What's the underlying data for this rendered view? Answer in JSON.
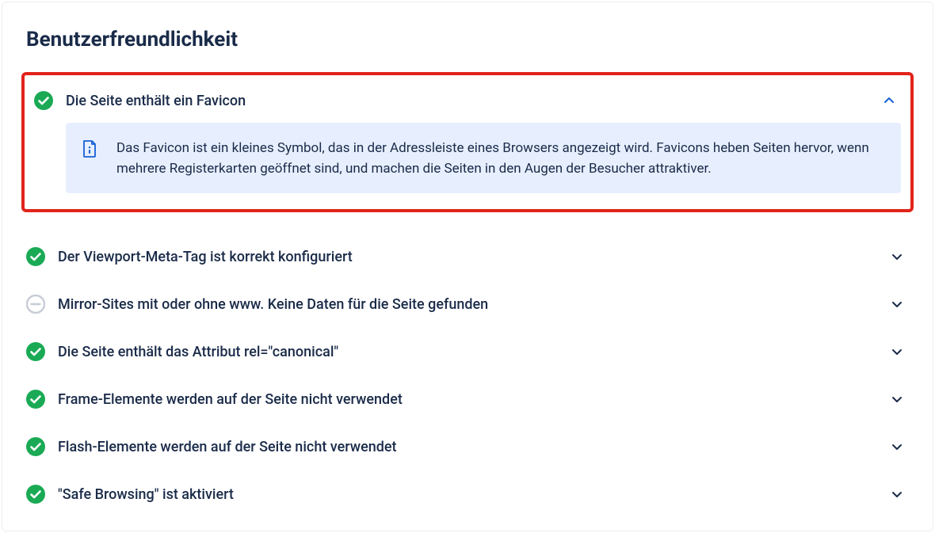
{
  "section_title": "Benutzerfreundlichkeit",
  "items": [
    {
      "status": "ok",
      "title": "Die Seite enthält ein Favicon",
      "expanded": true,
      "highlighted": true,
      "info": "Das Favicon ist ein kleines Symbol, das in der Adressleiste eines Browsers angezeigt wird. Favicons heben Seiten hervor, wenn mehrere Registerkarten geöffnet sind, und machen die Seiten in den Augen der Besucher attraktiver."
    },
    {
      "status": "ok",
      "title": "Der Viewport-Meta-Tag ist korrekt konfiguriert",
      "expanded": false
    },
    {
      "status": "neutral",
      "title": "Mirror-Sites mit oder ohne www. Keine Daten für die Seite gefunden",
      "expanded": false
    },
    {
      "status": "ok",
      "title": "Die Seite enthält das Attribut rel=\"canonical\"",
      "expanded": false
    },
    {
      "status": "ok",
      "title": "Frame-Elemente werden auf der Seite nicht verwendet",
      "expanded": false
    },
    {
      "status": "ok",
      "title": "Flash-Elemente werden auf der Seite nicht verwendet",
      "expanded": false
    },
    {
      "status": "ok",
      "title": "\"Safe Browsing\" ist aktiviert",
      "expanded": false
    }
  ],
  "colors": {
    "ok": "#1aaa55",
    "neutral": "#c7ccd6",
    "accent": "#1560d6",
    "highlight_border": "#e2231a",
    "info_bg": "#e7efff"
  }
}
